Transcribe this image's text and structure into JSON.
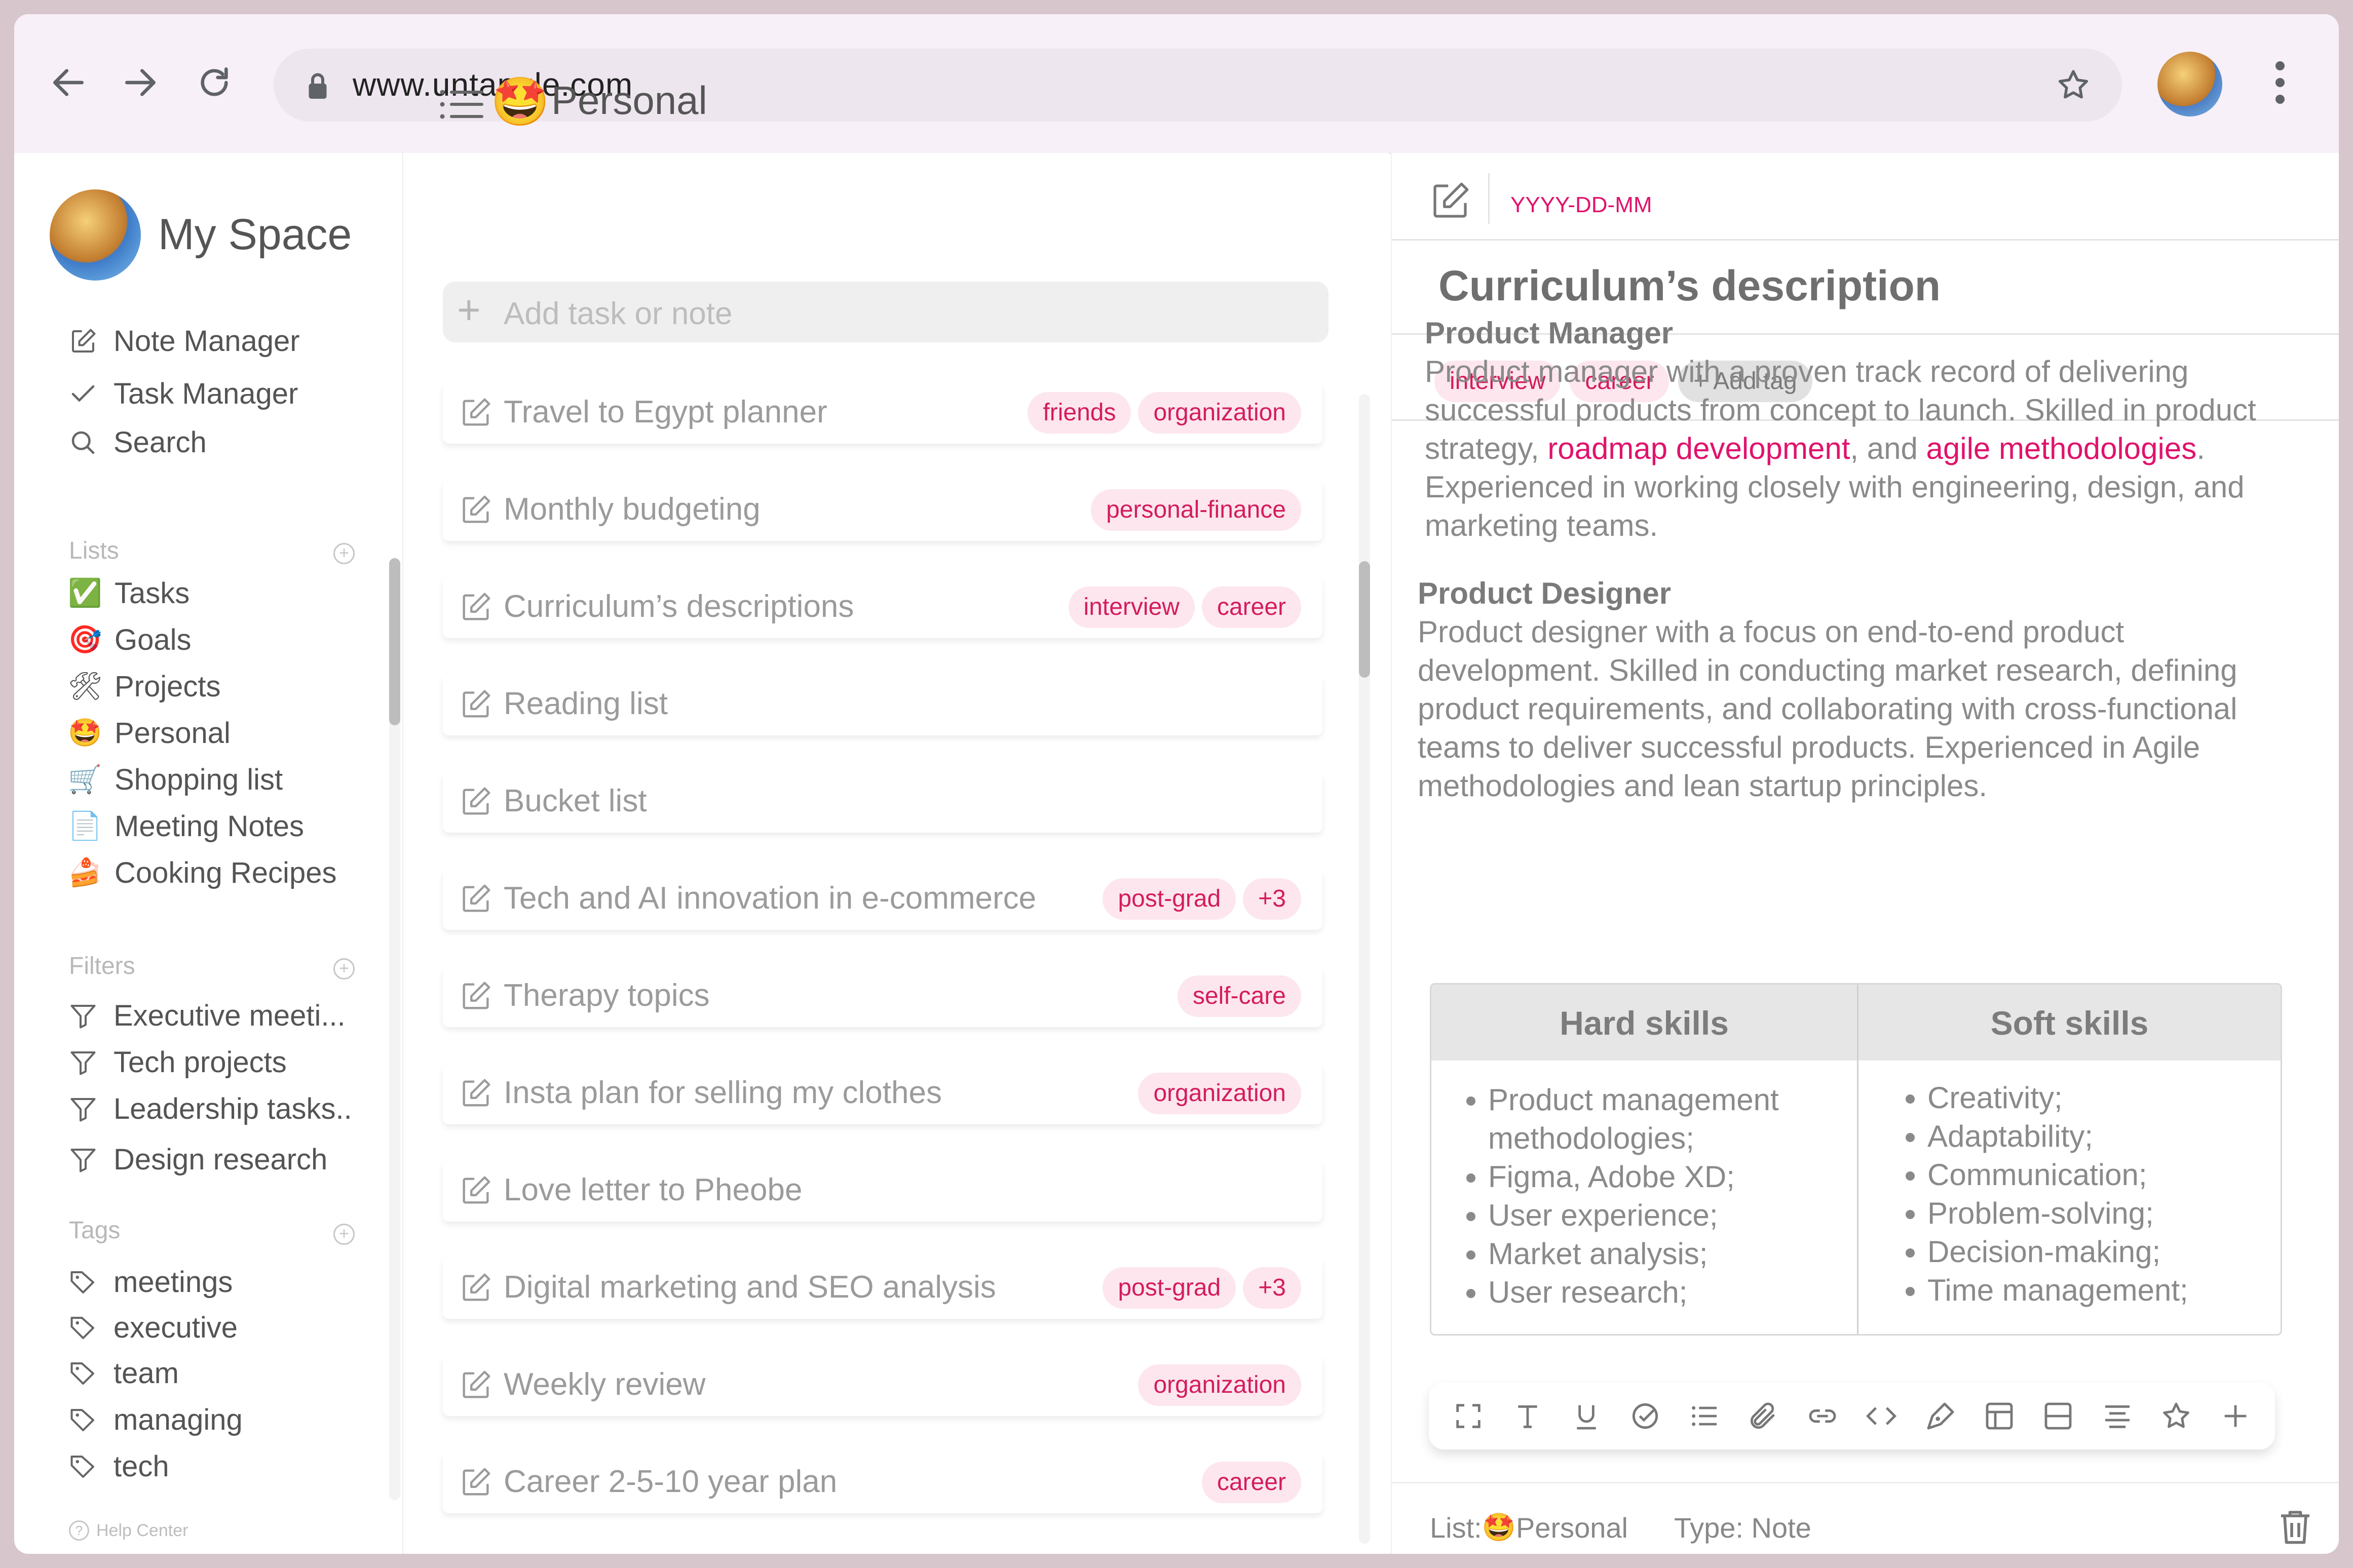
{
  "browser": {
    "url": "www.untangle.com"
  },
  "sidebar": {
    "space_title": "My Space",
    "nav": [
      {
        "label": "Note Manager",
        "icon": "note-edit-icon"
      },
      {
        "label": "Task Manager",
        "icon": "checkmark-icon"
      },
      {
        "label": "Search",
        "icon": "search-icon"
      }
    ],
    "lists_heading": "Lists",
    "lists": [
      {
        "label": "Tasks",
        "emoji": "✅"
      },
      {
        "label": "Goals",
        "emoji": "🎯"
      },
      {
        "label": "Projects",
        "emoji": "🛠"
      },
      {
        "label": "Personal",
        "emoji": "🤩"
      },
      {
        "label": "Shopping list",
        "emoji": "🛒"
      },
      {
        "label": "Meeting Notes",
        "emoji": "📄"
      },
      {
        "label": "Cooking Recipes",
        "emoji": "🍰"
      }
    ],
    "filters_heading": "Filters",
    "filters": [
      "Executive meeti...",
      "Tech projects",
      "Leadership tasks..",
      "Design research"
    ],
    "tags_heading": "Tags",
    "tags": [
      "meetings",
      "executive",
      "team",
      "managing",
      "tech"
    ],
    "help": "Help Center"
  },
  "middle": {
    "list_title": "Personal",
    "list_emoji": "🤩",
    "add_placeholder": "Add task or note",
    "tasks": [
      {
        "title": "Travel to Egypt planner",
        "tags": [
          "friends",
          "organization"
        ]
      },
      {
        "title": "Monthly budgeting",
        "tags": [
          "personal-finance"
        ]
      },
      {
        "title": "Curriculum’s descriptions",
        "tags": [
          "interview",
          "career"
        ]
      },
      {
        "title": "Reading list",
        "tags": []
      },
      {
        "title": "Bucket list",
        "tags": []
      },
      {
        "title": "Tech and AI innovation in e-commerce",
        "tags": [
          "post-grad",
          "+3"
        ]
      },
      {
        "title": "Therapy topics",
        "tags": [
          "self-care"
        ]
      },
      {
        "title": "Insta plan for selling my clothes",
        "tags": [
          "organization"
        ]
      },
      {
        "title": "Love letter to Pheobe",
        "tags": []
      },
      {
        "title": "Digital marketing and SEO analysis",
        "tags": [
          "post-grad",
          "+3"
        ]
      },
      {
        "title": "Weekly review",
        "tags": [
          "organization"
        ]
      },
      {
        "title": "Career 2-5-10 year plan",
        "tags": [
          "career"
        ]
      }
    ]
  },
  "detail": {
    "date_placeholder": "YYYY-DD-MM",
    "title": "Curriculum’s description",
    "tags": [
      "interview",
      "career"
    ],
    "add_tag": "+ Add tag",
    "pm_heading": "Product Manager",
    "pm_line1": "Product manager with a proven track record of delivering",
    "pm_line2": "successful products from concept to launch. Skilled in product",
    "pm_line3_pre": "strategy, ",
    "pm_link1": "roadmap development",
    "pm_line3_mid": ", and ",
    "pm_link2": "agile methodologies",
    "pm_line3_post": ".",
    "pm_line4": "Experienced in working closely with engineering, design, and",
    "pm_line5": "marketing teams.",
    "pd_heading": "Product Designer",
    "pd_line1": "Product designer with a focus on end-to-end product",
    "pd_line2": "development. Skilled in conducting market research, defining",
    "pd_line3": "product requirements, and collaborating with cross-functional",
    "pd_line4": "teams to deliver successful products. Experienced in Agile",
    "pd_line5": "methodologies and lean startup principles.",
    "hard_title": "Hard skills",
    "soft_title": "Soft skills",
    "hard_skills": [
      "Product management methodologies;",
      "Figma, Adobe XD;",
      "User experience;",
      "Market analysis;",
      "User research;"
    ],
    "soft_skills": [
      "Creativity;",
      "Adaptability;",
      "Communication;",
      "Problem-solving;",
      "Decision-making;",
      "Time management;"
    ],
    "footer_list_label": "List:",
    "footer_list_value": "Personal",
    "footer_list_emoji": "🤩",
    "footer_type": "Type: Note"
  },
  "colors": {
    "accent": "#e0136c",
    "tag_bg": "#fde6ee",
    "frame": "#d7c6cc"
  }
}
